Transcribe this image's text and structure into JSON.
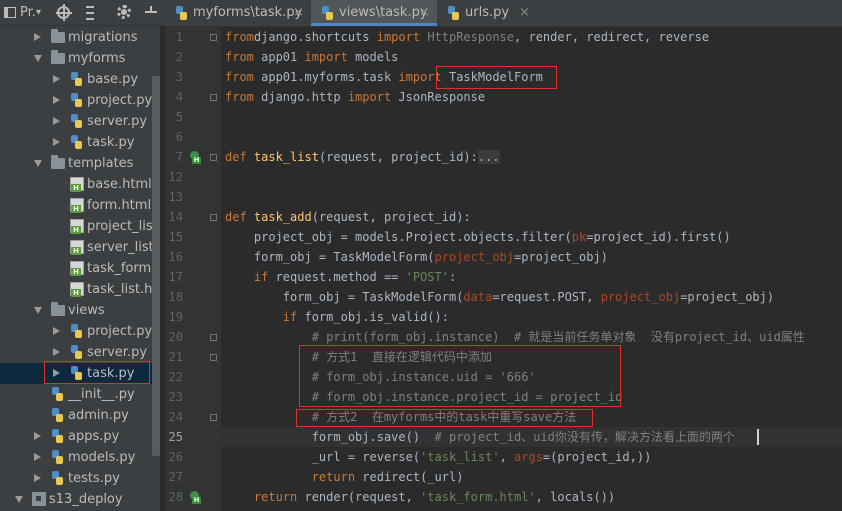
{
  "project_panel": {
    "title": "Pr.",
    "title_arrow": "▾",
    "icons": [
      "target-icon",
      "collapse-icon",
      "gear-icon",
      "hide-icon"
    ]
  },
  "tree": [
    {
      "label": "migrations",
      "type": "folder",
      "expanded": false
    },
    {
      "label": "myforms",
      "type": "folder",
      "expanded": true
    },
    {
      "label": "base.py",
      "type": "py",
      "expanded": false
    },
    {
      "label": "project.py",
      "type": "py",
      "expanded": false
    },
    {
      "label": "server.py",
      "type": "py",
      "expanded": false
    },
    {
      "label": "task.py",
      "type": "py",
      "expanded": false
    },
    {
      "label": "templates",
      "type": "folder",
      "expanded": true
    },
    {
      "label": "base.html",
      "type": "html"
    },
    {
      "label": "form.html",
      "type": "html"
    },
    {
      "label": "project_list.ht",
      "type": "html"
    },
    {
      "label": "server_list.htm",
      "type": "html"
    },
    {
      "label": "task_form.htm",
      "type": "html"
    },
    {
      "label": "task_list.html",
      "type": "html"
    },
    {
      "label": "views",
      "type": "folder",
      "expanded": true
    },
    {
      "label": "project.py",
      "type": "py",
      "expanded": false
    },
    {
      "label": "server.py",
      "type": "py",
      "expanded": false
    },
    {
      "label": "task.py",
      "type": "py",
      "expanded": false,
      "selected": true
    },
    {
      "label": "__init__.py",
      "type": "py"
    },
    {
      "label": "admin.py",
      "type": "py"
    },
    {
      "label": "apps.py",
      "type": "py",
      "expanded": false
    },
    {
      "label": "models.py",
      "type": "py",
      "expanded": false
    },
    {
      "label": "tests.py",
      "type": "py",
      "expanded": false
    },
    {
      "label": "s13_deploy",
      "type": "module",
      "expanded": true
    }
  ],
  "tabs": [
    {
      "label": "myforms\\task.py",
      "active": false
    },
    {
      "label": "views\\task.py",
      "active": true
    },
    {
      "label": "urls.py",
      "active": false
    }
  ],
  "tab_close": "×",
  "current_line": "25",
  "editor_lines": [
    {
      "n": "1",
      "segs": [
        [
          "kw",
          "from"
        ],
        [
          "",
          "django.shortcuts "
        ],
        [
          "kw",
          "import "
        ],
        [
          "cmt",
          "HttpResponse"
        ],
        [
          "",
          ", render, redirect, reverse"
        ]
      ]
    },
    {
      "n": "2",
      "segs": [
        [
          "kw",
          "from "
        ],
        [
          "",
          "app01 "
        ],
        [
          "kw",
          "import "
        ],
        [
          "",
          "models"
        ]
      ]
    },
    {
      "n": "3",
      "segs": [
        [
          "kw",
          "from "
        ],
        [
          "",
          "app01.myforms.task "
        ],
        [
          "kw",
          "import "
        ],
        [
          "",
          "TaskModelForm"
        ]
      ]
    },
    {
      "n": "4",
      "segs": [
        [
          "kw",
          "from "
        ],
        [
          "",
          "django.http "
        ],
        [
          "kw",
          "import "
        ],
        [
          "",
          "JsonResponse"
        ]
      ]
    },
    {
      "n": "5",
      "segs": []
    },
    {
      "n": "6",
      "segs": []
    },
    {
      "n": "7",
      "segs": [
        [
          "kw",
          "def "
        ],
        [
          "fn",
          "task_list"
        ],
        [
          "",
          "(request, project_id):"
        ],
        [
          "pill",
          "..."
        ]
      ]
    },
    {
      "n": "12",
      "segs": []
    },
    {
      "n": "13",
      "segs": []
    },
    {
      "n": "14",
      "segs": [
        [
          "kw",
          "def "
        ],
        [
          "fn",
          "task_add"
        ],
        [
          "",
          "(request, project_id):"
        ]
      ]
    },
    {
      "n": "15",
      "segs": [
        [
          "",
          "    project_obj = models.Project.objects.filter("
        ],
        [
          "prm",
          "pk"
        ],
        [
          "",
          "=project_id).first()"
        ]
      ]
    },
    {
      "n": "16",
      "segs": [
        [
          "",
          "    form_obj = TaskModelForm("
        ],
        [
          "prm",
          "project_obj"
        ],
        [
          "",
          "=project_obj)"
        ]
      ]
    },
    {
      "n": "17",
      "segs": [
        [
          "kw",
          "    if "
        ],
        [
          "",
          "request.method == "
        ],
        [
          "str",
          "'POST'"
        ],
        [
          "",
          ":"
        ]
      ]
    },
    {
      "n": "18",
      "segs": [
        [
          "",
          "        form_obj = TaskModelForm("
        ],
        [
          "prm",
          "data"
        ],
        [
          "",
          "=request.POST, "
        ],
        [
          "prm",
          "project_obj"
        ],
        [
          "",
          "=project_obj)"
        ]
      ]
    },
    {
      "n": "19",
      "segs": [
        [
          "kw",
          "        if "
        ],
        [
          "",
          "form_obj.is_valid():"
        ]
      ]
    },
    {
      "n": "20",
      "segs": [
        [
          "cmt",
          "            # print(form_obj.instance)  # 就是当前任务单对象  没有project_id、uid属性"
        ]
      ]
    },
    {
      "n": "21",
      "segs": [
        [
          "cmt",
          "            # 方式1  直接在逻辑代码中添加"
        ]
      ]
    },
    {
      "n": "22",
      "segs": [
        [
          "cmt",
          "            # form_obj.instance.uid = '666'"
        ]
      ]
    },
    {
      "n": "23",
      "segs": [
        [
          "cmt",
          "            # form_obj.instance.project_id = project_id"
        ]
      ]
    },
    {
      "n": "24",
      "segs": [
        [
          "cmt",
          "            # 方式2  在myforms中的task中重写save方法"
        ]
      ]
    },
    {
      "n": "25",
      "segs": [
        [
          "",
          "            form_obj.save()  "
        ],
        [
          "cmt",
          "# project_id、uid你没有传，解决方法看上面的两个"
        ]
      ]
    },
    {
      "n": "26",
      "segs": [
        [
          "",
          "            _url = reverse("
        ],
        [
          "str",
          "'task_list'"
        ],
        [
          "",
          ", "
        ],
        [
          "prm",
          "args"
        ],
        [
          "",
          "=(project_id,))"
        ]
      ]
    },
    {
      "n": "27",
      "segs": [
        [
          "kw",
          "            return "
        ],
        [
          "",
          "redirect(_url)"
        ]
      ]
    },
    {
      "n": "28",
      "segs": [
        [
          "kw",
          "    return "
        ],
        [
          "",
          "render(request, "
        ],
        [
          "str",
          "'task_form.html'"
        ],
        [
          "",
          ", locals())"
        ]
      ]
    }
  ]
}
